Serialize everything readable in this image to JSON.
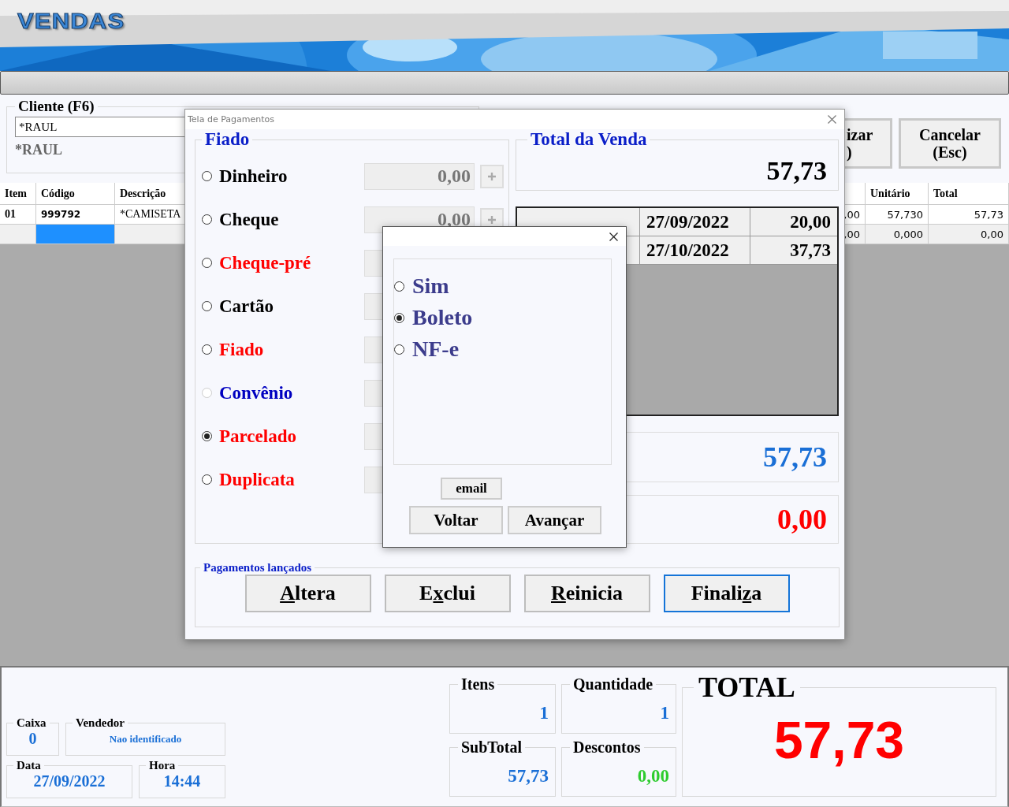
{
  "app_title": "VENDAS",
  "client": {
    "legend": "Cliente (F6)",
    "value": "*RAUL",
    "name": "*RAUL"
  },
  "side_buttons": [
    {
      "lines": [
        "izar",
        ")"
      ]
    },
    {
      "lines": [
        "Cancelar",
        "(Esc)"
      ]
    }
  ],
  "table": {
    "columns": [
      "Item",
      "Código",
      "Descrição",
      "Unitário",
      "Total"
    ],
    "rows": [
      {
        "selected": false,
        "item": "01",
        "codigo": "999792",
        "descricao": "*CAMISETA",
        "column_4": ",00",
        "unitario": "57,730",
        "total": "57,73"
      },
      {
        "selected": true,
        "column_4": ",00",
        "unitario": "0,000",
        "total": "0,00"
      }
    ]
  },
  "status": {
    "caixa_label": "Caixa",
    "caixa": "0",
    "vendedor_label": "Vendedor",
    "vendedor": "Nao identificado",
    "data_label": "Data",
    "data": "27/09/2022",
    "hora_label": "Hora",
    "hora": "14:44",
    "itens_label": "Itens",
    "itens": "1",
    "quantidade_label": "Quantidade",
    "quantidade": "1",
    "subtotal_label": "SubTotal",
    "subtotal": "57,73",
    "descontos_label": "Descontos",
    "descontos": "0,00",
    "total_label": "TOTAL",
    "total": "57,73"
  },
  "dialog": {
    "title": "Tela de Pagamentos",
    "legend": "Fiado",
    "methods": [
      {
        "label": "Dinheiro",
        "color": "#000000",
        "selected": false,
        "disabled": false,
        "value": "0,00"
      },
      {
        "label": "Cheque",
        "color": "#000000",
        "selected": false,
        "disabled": false,
        "value": "0,00"
      },
      {
        "label": "Cheque-pré",
        "color": "#ff0000",
        "selected": false,
        "disabled": false
      },
      {
        "label": "Cartão",
        "color": "#000000",
        "selected": false,
        "disabled": false
      },
      {
        "label": "Fiado",
        "color": "#ff0000",
        "selected": false,
        "disabled": false
      },
      {
        "label": "Convênio",
        "color": "#0000c0",
        "selected": false,
        "disabled": true
      },
      {
        "label": "Parcelado",
        "color": "#ff0000",
        "selected": true,
        "disabled": false
      },
      {
        "label": "Duplicata",
        "color": "#ff0000",
        "selected": false,
        "disabled": false
      }
    ],
    "total_legend": "Total da Venda",
    "total": "57,73",
    "payments": [
      {
        "date": "27/09/2022",
        "amount": "20,00"
      },
      {
        "date": "27/10/2022",
        "amount": "37,73"
      }
    ],
    "value_2": "57,73",
    "value_3": "0,00",
    "launched_legend": "Pagamentos lançados",
    "actions": [
      {
        "key": "A",
        "after": "ltera",
        "focused": false
      },
      {
        "before": "E",
        "key": "x",
        "after": "clui",
        "focused": false
      },
      {
        "key": "R",
        "after": "einicia",
        "focused": false
      },
      {
        "before": "Finali",
        "key": "z",
        "after": "a",
        "focused": true
      }
    ]
  },
  "popup": {
    "options": [
      {
        "label": "Sim",
        "selected": false
      },
      {
        "label": "Boleto",
        "selected": true
      },
      {
        "label": "NF-e",
        "selected": false
      }
    ],
    "email_button": "email",
    "buttons": [
      "Voltar",
      "Avançar"
    ]
  }
}
